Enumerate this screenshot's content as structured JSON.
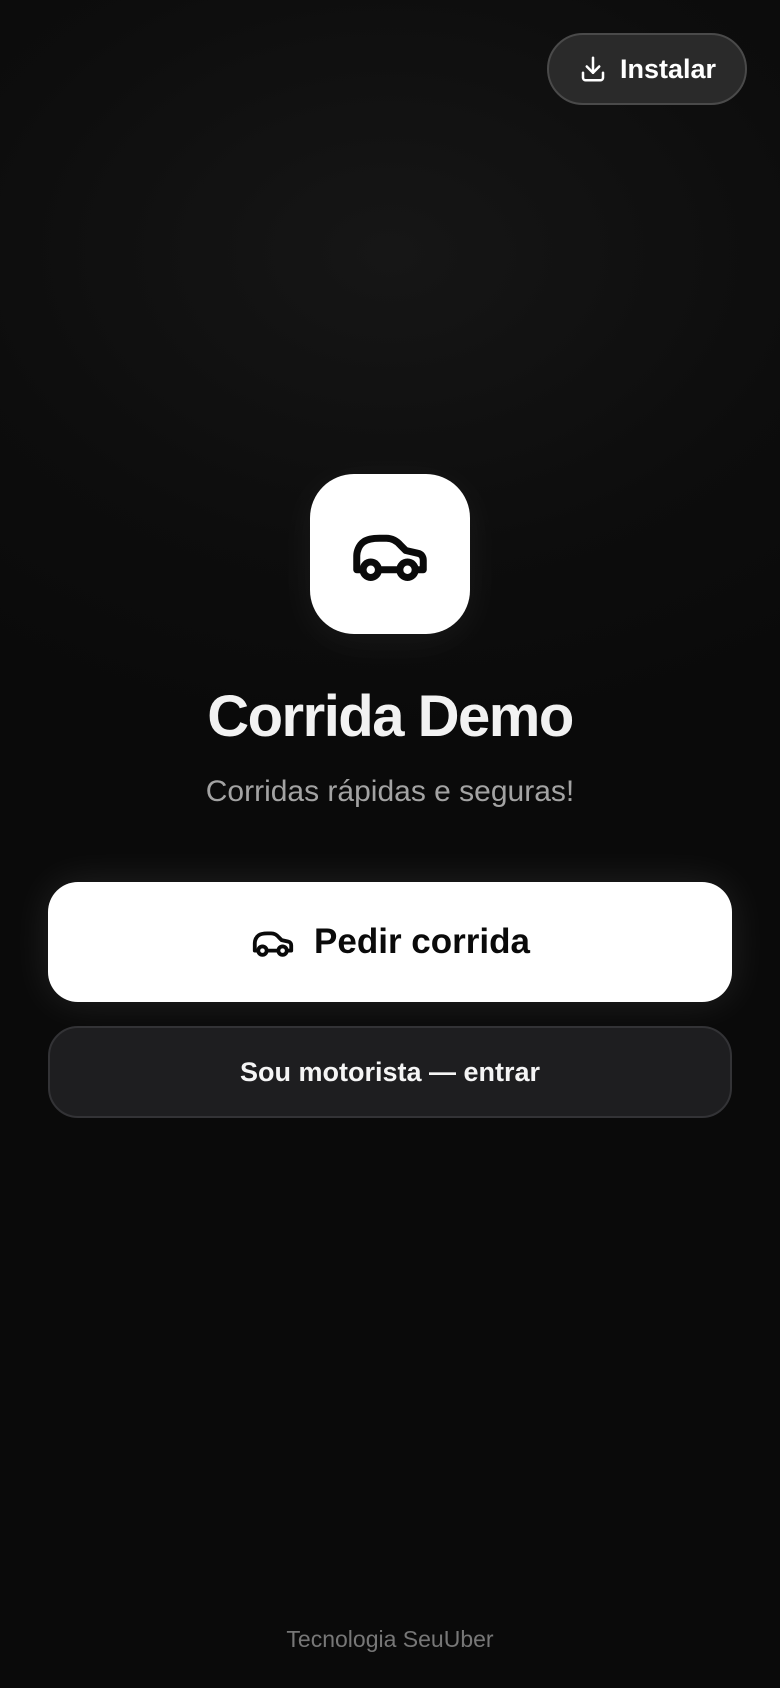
{
  "header": {
    "install_label": "Instalar",
    "install_icon": "download-icon"
  },
  "brand": {
    "logo_icon": "car-icon",
    "title": "Corrida Demo",
    "subtitle": "Corridas rápidas e seguras!"
  },
  "actions": {
    "primary_label": "Pedir corrida",
    "primary_icon": "car-icon",
    "secondary_label": "Sou motorista — entrar"
  },
  "footer": {
    "text": "Tecnologia SeuUber"
  },
  "colors": {
    "background": "#0a0a0a",
    "primary_button": "#ffffff",
    "secondary_button": "#1e1e20",
    "subtitle_text": "#a3a3a3",
    "footer_text": "#777777"
  }
}
